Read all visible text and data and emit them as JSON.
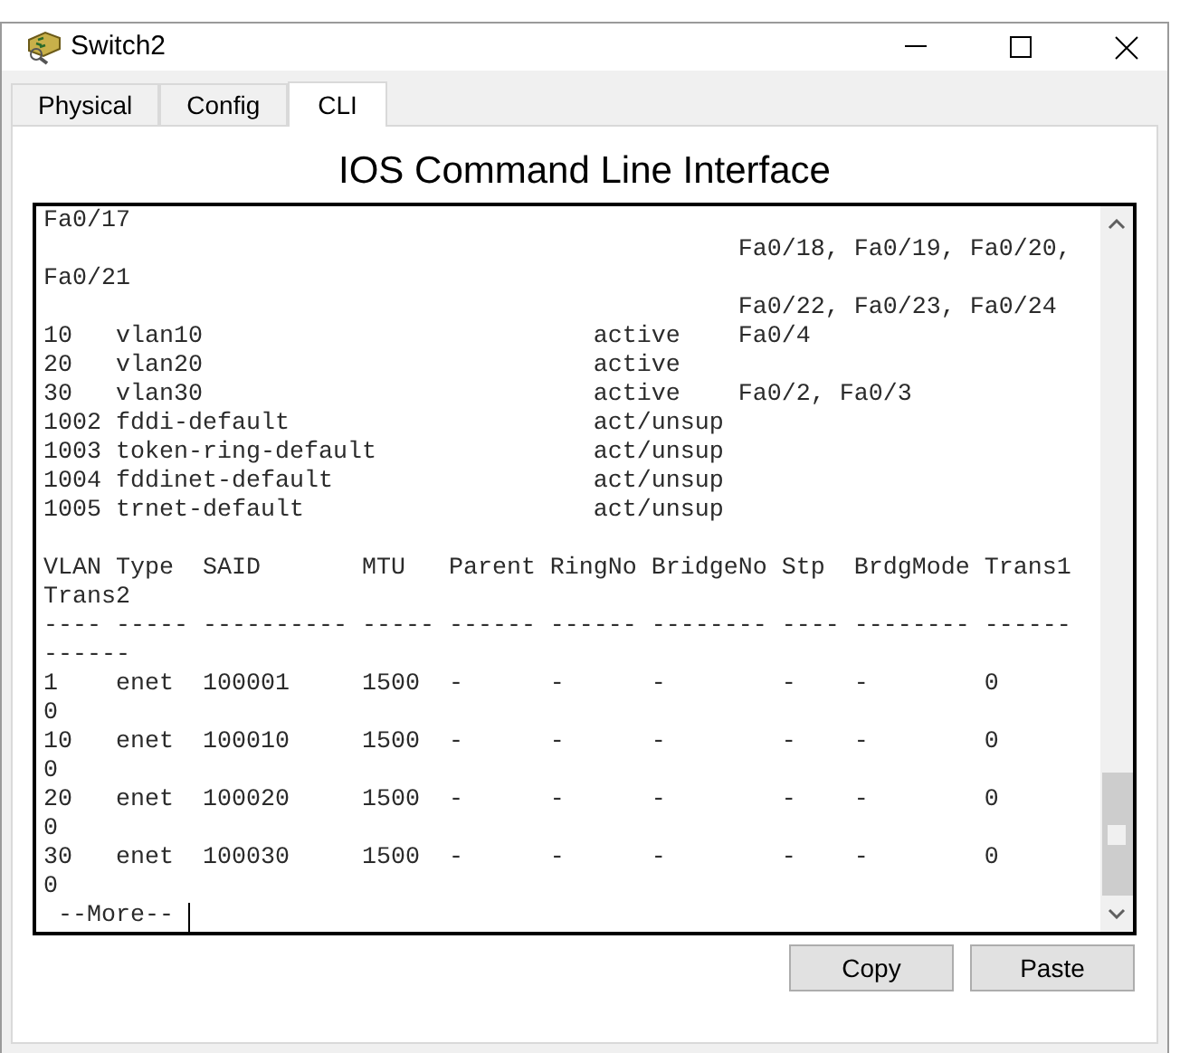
{
  "window": {
    "title": "Switch2"
  },
  "tabs": [
    {
      "label": "Physical",
      "selected": false
    },
    {
      "label": "Config",
      "selected": false
    },
    {
      "label": "CLI",
      "selected": true
    }
  ],
  "heading": "IOS Command Line Interface",
  "terminal": {
    "blocks": [
      [
        "Fa0/17",
        "                                                Fa0/18, Fa0/19, Fa0/20,",
        "Fa0/21",
        "                                                Fa0/22, Fa0/23, Fa0/24",
        "10   vlan10                           active    Fa0/4",
        "20   vlan20                           active",
        "30   vlan30                           active    Fa0/2, Fa0/3",
        "1002 fddi-default                     act/unsup",
        "1003 token-ring-default               act/unsup",
        "1004 fddinet-default                  act/unsup",
        "1005 trnet-default                    act/unsup"
      ],
      [
        "VLAN Type  SAID       MTU   Parent RingNo BridgeNo Stp  BrdgMode Trans1",
        "Trans2",
        "---- ----- ---------- ----- ------ ------ -------- ---- -------- ------",
        "------",
        "1    enet  100001     1500  -      -      -        -    -        0",
        "0",
        "10   enet  100010     1500  -      -      -        -    -        0",
        "0",
        "20   enet  100020     1500  -      -      -        -    -        0",
        "0",
        "30   enet  100030     1500  -      -      -        -    -        0",
        "0"
      ]
    ],
    "prompt": " --More-- "
  },
  "buttons": [
    "Copy",
    "Paste"
  ]
}
